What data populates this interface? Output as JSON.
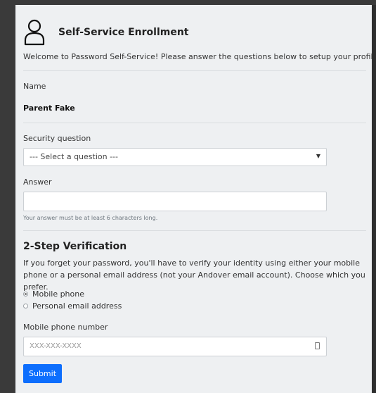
{
  "header": {
    "title": "Self-Service Enrollment"
  },
  "welcome": "Welcome to Password Self-Service! Please answer the questions below to setup your profile.",
  "name": {
    "label": "Name",
    "value": "Parent Fake"
  },
  "security": {
    "label": "Security question",
    "selected": "--- Select a question ---",
    "caret": "▼"
  },
  "answer": {
    "label": "Answer",
    "value": "",
    "help": "Your answer must be at least 6 characters long."
  },
  "two_step": {
    "heading": "2-Step Verification",
    "description": "If you forget your password, you'll have to verify your identity using either your mobile phone or a personal email address (not your Andover email account). Choose which you prefer.",
    "options": [
      "Mobile phone",
      "Personal email address"
    ],
    "selected_option": "Mobile phone"
  },
  "phone": {
    "label": "Mobile phone number",
    "placeholder": "XXX-XXX-XXXX"
  },
  "submit_label": "Submit",
  "colors": {
    "accent": "#0d6efd",
    "panel": "#eef0f2"
  }
}
